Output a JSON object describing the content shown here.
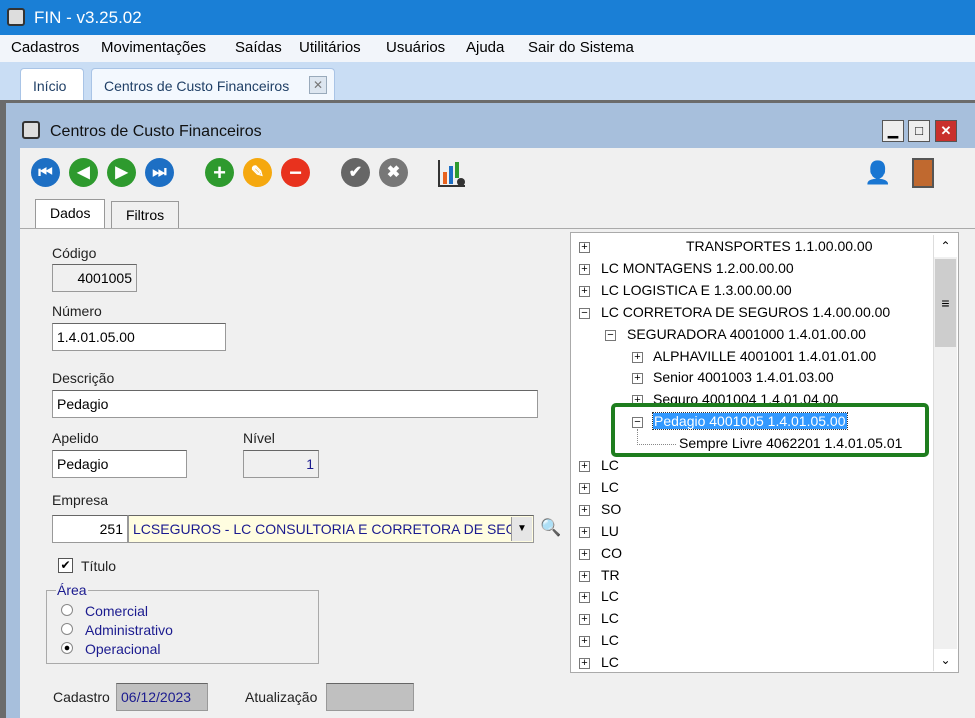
{
  "app": {
    "title": "FIN - v3.25.02"
  },
  "menu": [
    "Cadastros",
    "Movimentações",
    "Saídas",
    "Utilitários",
    "Usuários",
    "Ajuda",
    "Sair do Sistema"
  ],
  "app_tabs": [
    {
      "label": "Início"
    },
    {
      "label": "Centros de Custo Financeiros"
    }
  ],
  "window": {
    "title": "Centros de Custo Financeiros"
  },
  "form_tabs": [
    "Dados",
    "Filtros"
  ],
  "form": {
    "codigo_label": "Código",
    "codigo": "4001005",
    "numero_label": "Número",
    "numero": "1.4.01.05.00",
    "descricao_label": "Descrição",
    "descricao": "Pedagio",
    "apelido_label": "Apelido",
    "apelido": "Pedagio",
    "nivel_label": "Nível",
    "nivel": "1",
    "empresa_label": "Empresa",
    "empresa_codigo": "251",
    "empresa_nome": "LCSEGUROS - LC CONSULTORIA E CORRETORA DE SEGI",
    "titulo_label": "Título",
    "titulo_checked": true,
    "area_label": "Área",
    "area_options": [
      "Comercial",
      "Administrativo",
      "Operacional"
    ],
    "area_selected": "Operacional",
    "cadastro_label": "Cadastro",
    "cadastro": "06/12/2023",
    "atualizacao_label": "Atualização",
    "atualizacao": ""
  },
  "tree": [
    {
      "label": "TRANSPORTES 1.1.00.00.00",
      "level": 0,
      "state": "+"
    },
    {
      "label": "LC MONTAGENS 1.2.00.00.00",
      "level": 0,
      "state": "+"
    },
    {
      "label": "LC LOGISTICA E  1.3.00.00.00",
      "level": 0,
      "state": "+"
    },
    {
      "label": "LC CORRETORA DE SEGUROS 1.4.00.00.00",
      "level": 0,
      "state": "-"
    },
    {
      "label": "SEGURADORA 4001000 1.4.01.00.00",
      "level": 1,
      "state": "-"
    },
    {
      "label": "ALPHAVILLE 4001001 1.4.01.01.00",
      "level": 2,
      "state": "+"
    },
    {
      "label": "Senior 4001003 1.4.01.03.00",
      "level": 2,
      "state": "+"
    },
    {
      "label": "Seguro 4001004 1.4.01.04.00",
      "level": 2,
      "state": "+"
    },
    {
      "label": "Pedagio 4001005 1.4.01.05.00",
      "level": 2,
      "state": "-",
      "selected": true
    },
    {
      "label": "Sempre Livre 4062201 1.4.01.05.01",
      "level": 3,
      "state": ""
    },
    {
      "label": "LC",
      "level": 0,
      "state": "+"
    },
    {
      "label": "LC",
      "level": 0,
      "state": "+"
    },
    {
      "label": "SO",
      "level": 0,
      "state": "+"
    },
    {
      "label": "LU",
      "level": 0,
      "state": "+"
    },
    {
      "label": "CO",
      "level": 0,
      "state": "+"
    },
    {
      "label": "TR",
      "level": 0,
      "state": "+"
    },
    {
      "label": "LC",
      "level": 0,
      "state": "+"
    },
    {
      "label": "LC",
      "level": 0,
      "state": "+"
    },
    {
      "label": "LC",
      "level": 0,
      "state": "+"
    },
    {
      "label": "LC",
      "level": 0,
      "state": "+"
    }
  ],
  "colors": {
    "titlebar": "#1a7fd6",
    "highlight": "#1e7d1e",
    "selection": "#3399ff"
  }
}
